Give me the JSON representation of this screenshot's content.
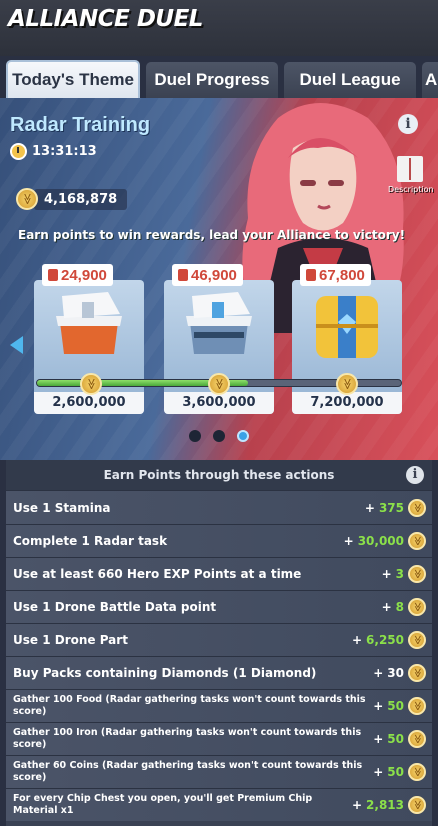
{
  "header": {
    "title": "ALLIANCE DUEL"
  },
  "tabs": [
    {
      "label": "Today's Theme"
    },
    {
      "label": "Duel Progress"
    },
    {
      "label": "Duel League"
    },
    {
      "label": "A"
    }
  ],
  "event": {
    "name": "Radar Training",
    "timer": "13:31:13",
    "description_label": "Description",
    "points": "4,168,878",
    "tagline": "Earn points to win rewards, lead your Alliance to victory!"
  },
  "chests": [
    {
      "price": "24,900",
      "requirement": "2,600,000",
      "color": "#e2672e"
    },
    {
      "price": "46,900",
      "requirement": "3,600,000",
      "color": "#a9c4e2"
    },
    {
      "price": "67,800",
      "requirement": "7,200,000",
      "color": "#f2c33a"
    }
  ],
  "progress_fraction": 0.58,
  "actions": {
    "header": "Earn Points through these actions",
    "items": [
      {
        "label": "Use 1 Stamina",
        "points": "375"
      },
      {
        "label": "Complete 1 Radar task",
        "points": "30,000"
      },
      {
        "label": "Use at least 660 Hero EXP Points at a time",
        "points": "3"
      },
      {
        "label": "Use 1 Drone Battle Data point",
        "points": "8"
      },
      {
        "label": "Use 1 Drone Part",
        "points": "6,250"
      },
      {
        "label": "Buy Packs containing Diamonds (1 Diamond)",
        "points": "30"
      },
      {
        "label": "Gather 100 Food (Radar gathering tasks won't count towards this score)",
        "points": "50"
      },
      {
        "label": "Gather 100 Iron (Radar gathering tasks won't count towards this score)",
        "points": "50"
      },
      {
        "label": "Gather 60 Coins (Radar gathering tasks won't count towards this score)",
        "points": "50"
      },
      {
        "label": "For every Chip Chest you open, you'll get Premium Chip Material x1",
        "points": "2,813"
      }
    ]
  }
}
